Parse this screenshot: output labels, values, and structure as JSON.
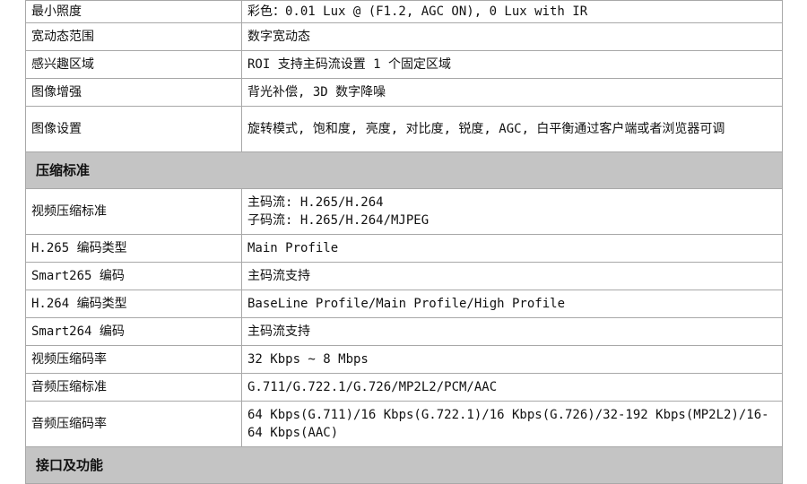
{
  "rows": [
    {
      "type": "row",
      "key": "最小照度",
      "value": "彩色：0.01 Lux @ (F1.2, AGC ON), 0 Lux with IR"
    },
    {
      "type": "row",
      "key": "宽动态范围",
      "value": "数字宽动态"
    },
    {
      "type": "row",
      "key": "感兴趣区域",
      "value": "ROI 支持主码流设置 1 个固定区域"
    },
    {
      "type": "row",
      "key": "图像增强",
      "value": "背光补偿, 3D 数字降噪"
    },
    {
      "type": "row",
      "key": "图像设置",
      "value": "旋转模式, 饱和度, 亮度, 对比度, 锐度, AGC, 白平衡通过客户端或者浏览器可调"
    },
    {
      "type": "header",
      "key": "压缩标准"
    },
    {
      "type": "row",
      "key": "视频压缩标准",
      "value_lines": [
        "主码流: H.265/H.264",
        "子码流: H.265/H.264/MJPEG"
      ]
    },
    {
      "type": "row",
      "key": "H.265 编码类型",
      "value": "Main Profile"
    },
    {
      "type": "row",
      "key": "Smart265 编码",
      "value": "主码流支持"
    },
    {
      "type": "row",
      "key": "H.264 编码类型",
      "value": "BaseLine Profile/Main Profile/High Profile"
    },
    {
      "type": "row",
      "key": "Smart264 编码",
      "value": "主码流支持"
    },
    {
      "type": "row",
      "key": "视频压缩码率",
      "value": "32 Kbps ~ 8 Mbps"
    },
    {
      "type": "row",
      "key": "音频压缩标准",
      "value": "G.711/G.722.1/G.726/MP2L2/PCM/AAC"
    },
    {
      "type": "row",
      "key": "音频压缩码率",
      "value": "64 Kbps(G.711)/16 Kbps(G.722.1)/16 Kbps(G.726)/32-192 Kbps(MP2L2)/16-64 Kbps(AAC)"
    },
    {
      "type": "header",
      "key": "接口及功能"
    }
  ]
}
